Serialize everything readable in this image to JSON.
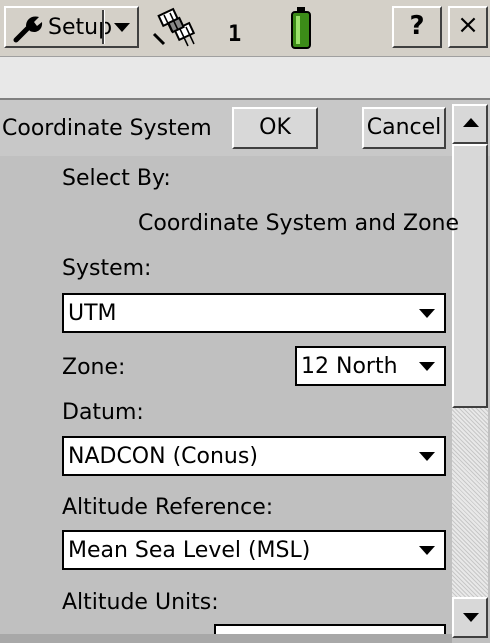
{
  "topbar": {
    "setup_label": "Setup",
    "satellite_count": "1",
    "help_label": "?",
    "close_label": "×",
    "icons": [
      "wrench-icon",
      "satellite-icon",
      "battery-icon"
    ]
  },
  "form": {
    "title": "Coordinate System",
    "ok_label": "OK",
    "cancel_label": "Cancel",
    "select_by_label": "Select By:",
    "select_by_value": "Coordinate System and Zone",
    "system_label": "System:",
    "system_value": "UTM",
    "zone_label": "Zone:",
    "zone_value": "12 North",
    "datum_label": "Datum:",
    "datum_value": "NADCON (Conus)",
    "altitude_reference_label": "Altitude Reference:",
    "altitude_reference_value": "Mean Sea Level (MSL)",
    "altitude_units_label": "Altitude Units:"
  },
  "colors": {
    "window_bg": "#c0c0c0",
    "battery_green": "#3c8c18"
  }
}
